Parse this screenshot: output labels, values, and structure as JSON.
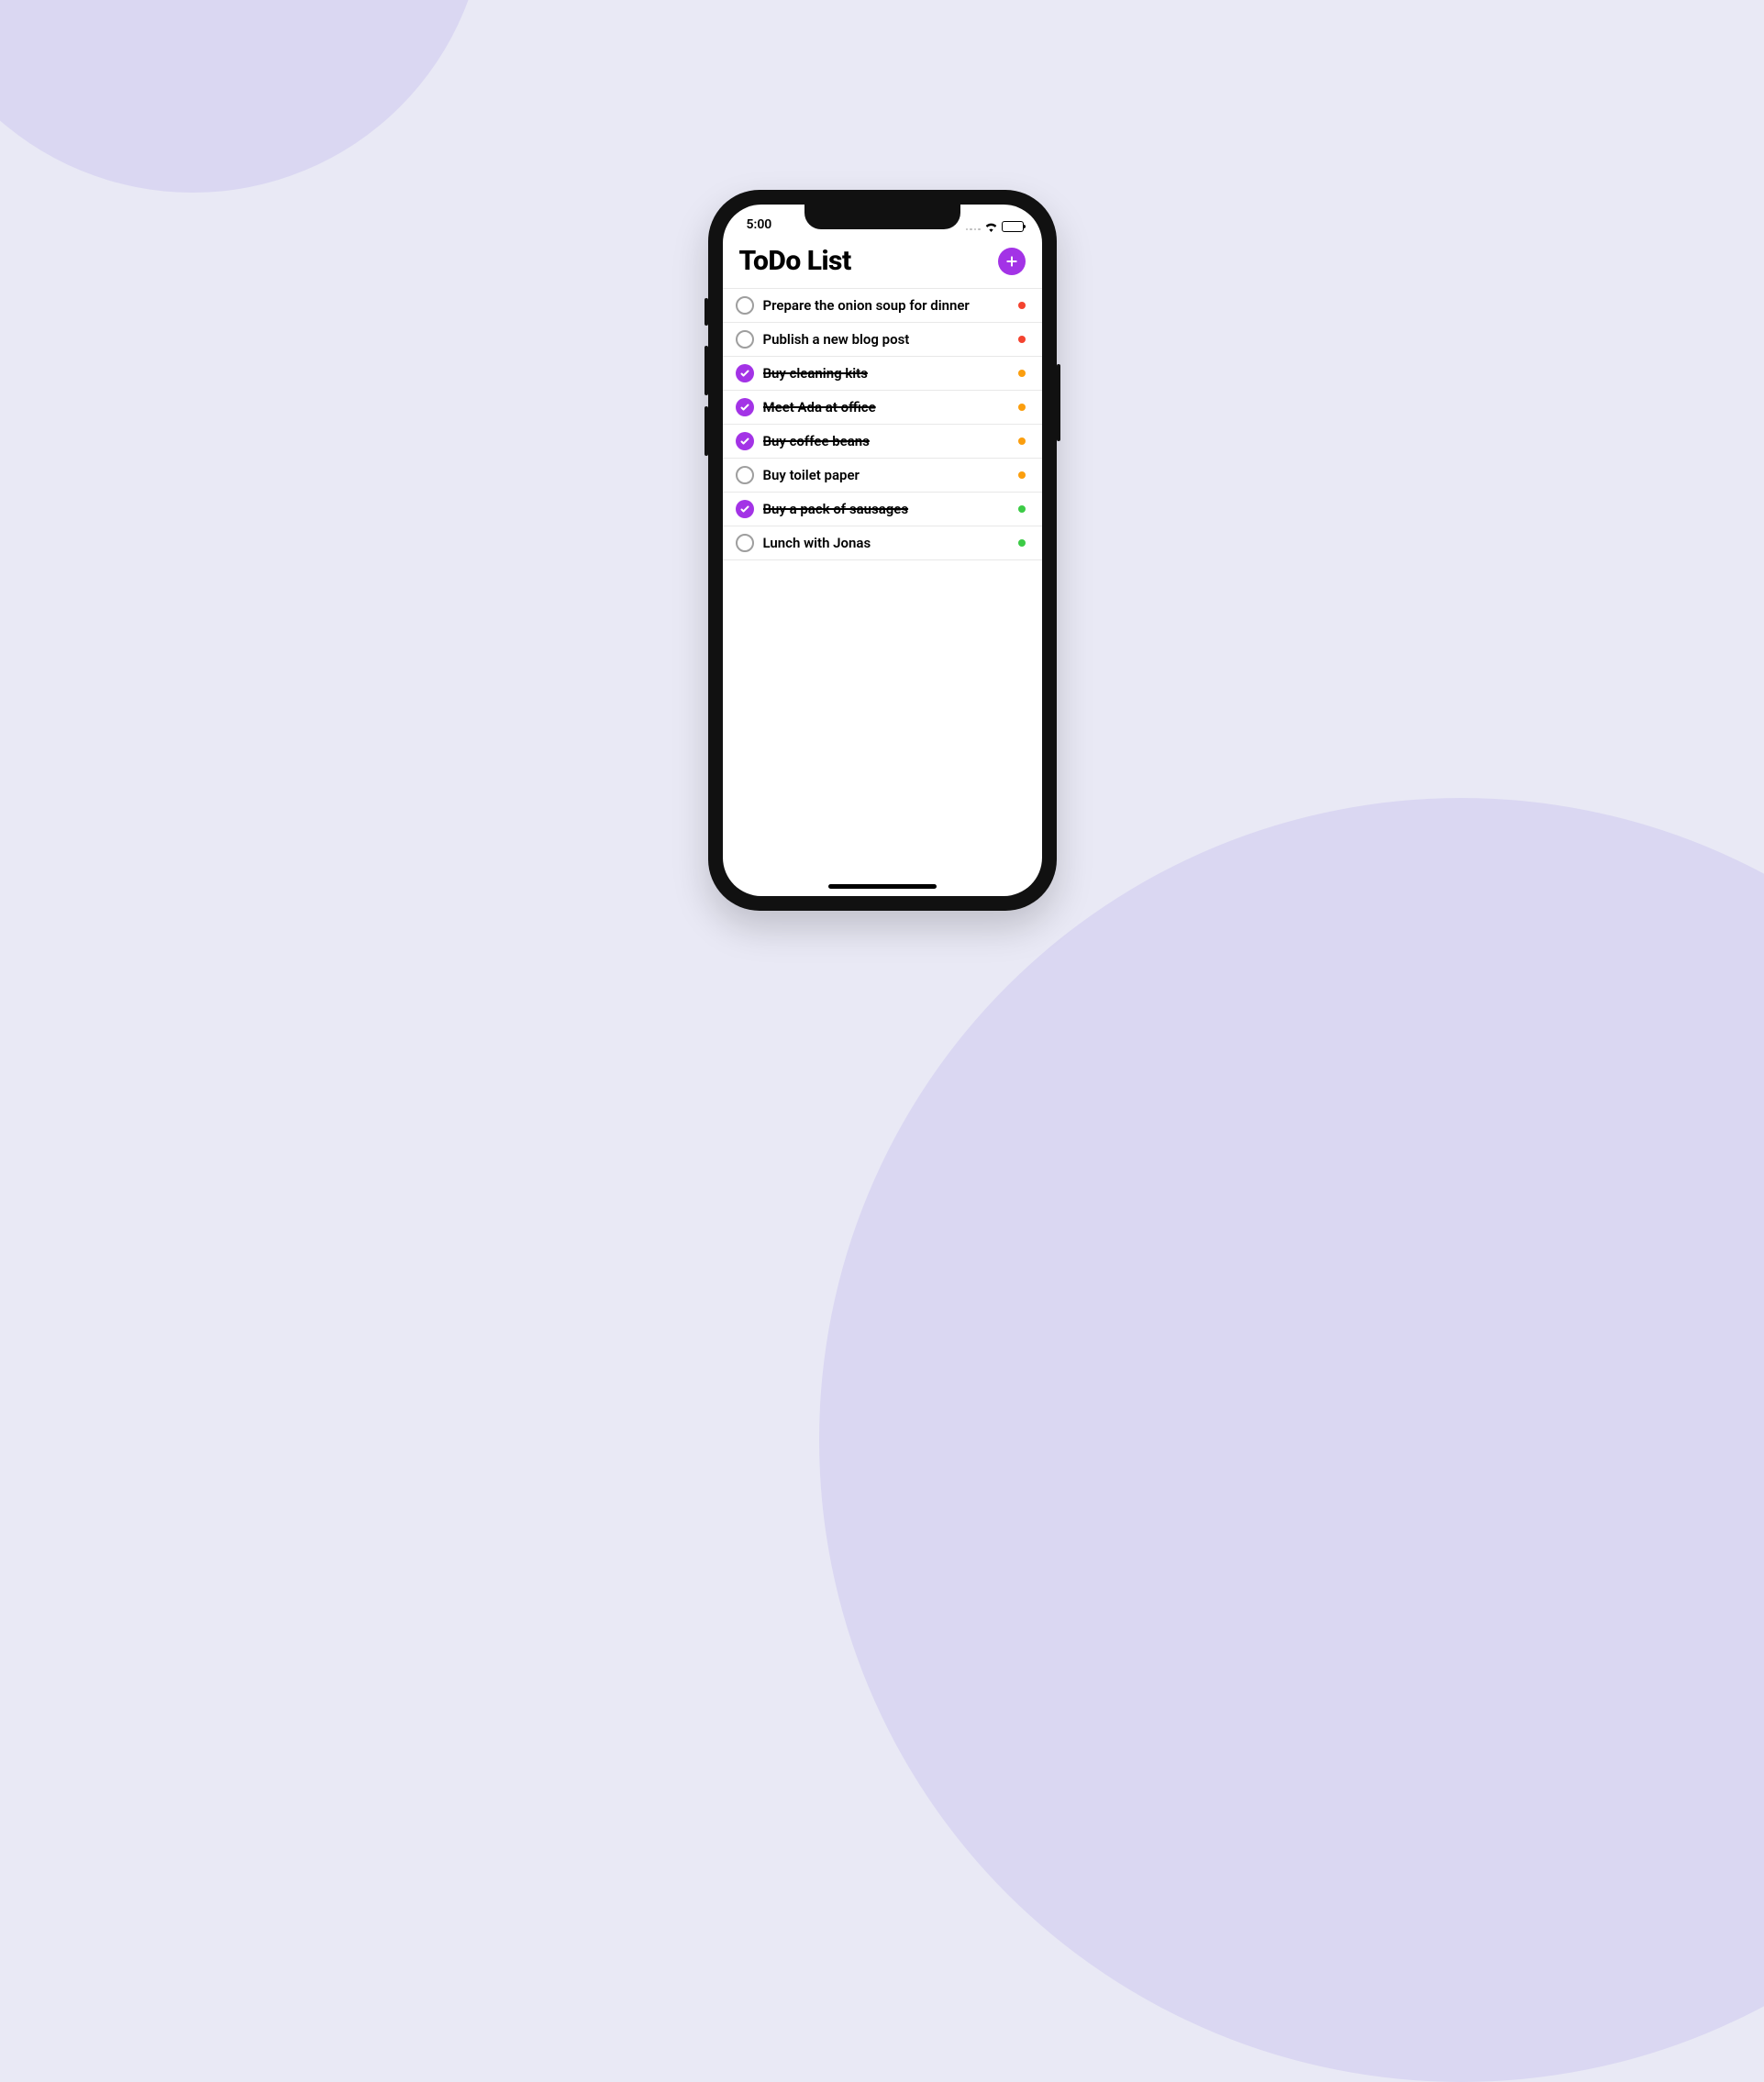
{
  "status_bar": {
    "time": "5:00"
  },
  "header": {
    "title": "ToDo List"
  },
  "colors": {
    "accent": "#A333E6",
    "priority": {
      "red": "#F4432F",
      "orange": "#FB9E0E",
      "green": "#3CCB46"
    }
  },
  "todos": [
    {
      "label": "Prepare the onion soup for dinner",
      "completed": false,
      "priority": "red"
    },
    {
      "label": "Publish a new blog post",
      "completed": false,
      "priority": "red"
    },
    {
      "label": "Buy cleaning kits",
      "completed": true,
      "priority": "orange"
    },
    {
      "label": "Meet Ada at office",
      "completed": true,
      "priority": "orange"
    },
    {
      "label": "Buy coffee beans",
      "completed": true,
      "priority": "orange"
    },
    {
      "label": "Buy toilet paper",
      "completed": false,
      "priority": "orange"
    },
    {
      "label": "Buy a pack of sausages",
      "completed": true,
      "priority": "green"
    },
    {
      "label": "Lunch with Jonas",
      "completed": false,
      "priority": "green"
    }
  ]
}
